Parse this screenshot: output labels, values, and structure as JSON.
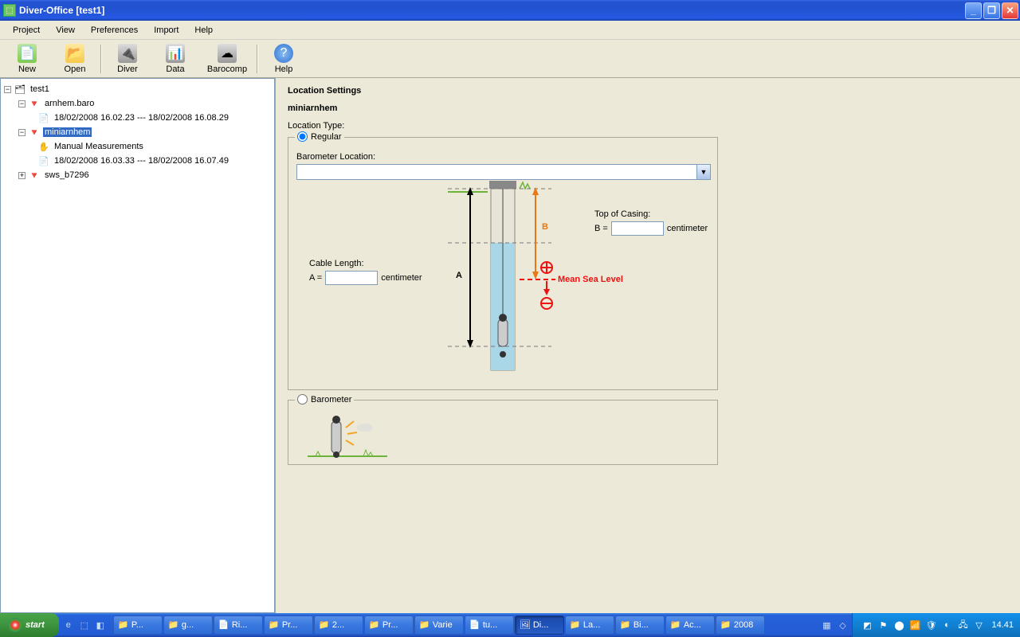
{
  "window": {
    "title": "Diver-Office [test1]"
  },
  "menu": {
    "items": [
      "Project",
      "View",
      "Preferences",
      "Import",
      "Help"
    ]
  },
  "toolbar": {
    "new": "New",
    "open": "Open",
    "diver": "Diver",
    "data": "Data",
    "barocomp": "Barocomp",
    "help": "Help"
  },
  "tree": {
    "root": "test1",
    "n1": "arnhem.baro",
    "n1a": "18/02/2008 16.02.23  ---  18/02/2008 16.08.29",
    "n2": "miniarnhem",
    "n2a": "Manual Measurements",
    "n2b": "18/02/2008 16.03.33  ---  18/02/2008 16.07.49",
    "n3": "sws_b7296"
  },
  "content": {
    "heading": "Location Settings",
    "subheading": "miniarnhem",
    "loc_type_label": "Location Type:",
    "regular_label": "Regular",
    "barometer_loc_label": "Barometer Location:",
    "cable_length_label": "Cable Length:",
    "a_label": "A = ",
    "a_unit": "centimeter",
    "top_casing_label": "Top of Casing:",
    "b_label": "B = ",
    "b_unit": "centimeter",
    "diag_A": "A",
    "diag_B": "B",
    "mean_sea": "Mean Sea Level",
    "barometer_radio": "Barometer"
  },
  "taskbar": {
    "start": "start",
    "items": [
      {
        "label": "P...",
        "icon": "📁"
      },
      {
        "label": "g...",
        "icon": "📁"
      },
      {
        "label": "Ri...",
        "icon": "📄"
      },
      {
        "label": "Pr...",
        "icon": "📁"
      },
      {
        "label": "2...",
        "icon": "📁"
      },
      {
        "label": "Pr...",
        "icon": "📁"
      },
      {
        "label": "Varie",
        "icon": "📁"
      },
      {
        "label": "tu...",
        "icon": "📄"
      },
      {
        "label": "Di...",
        "icon": "🖼",
        "active": true
      },
      {
        "label": "La...",
        "icon": "📁"
      },
      {
        "label": "Bi...",
        "icon": "📁"
      },
      {
        "label": "Ac...",
        "icon": "📁"
      },
      {
        "label": "2008",
        "icon": "📁"
      }
    ],
    "clock": "14.41"
  }
}
